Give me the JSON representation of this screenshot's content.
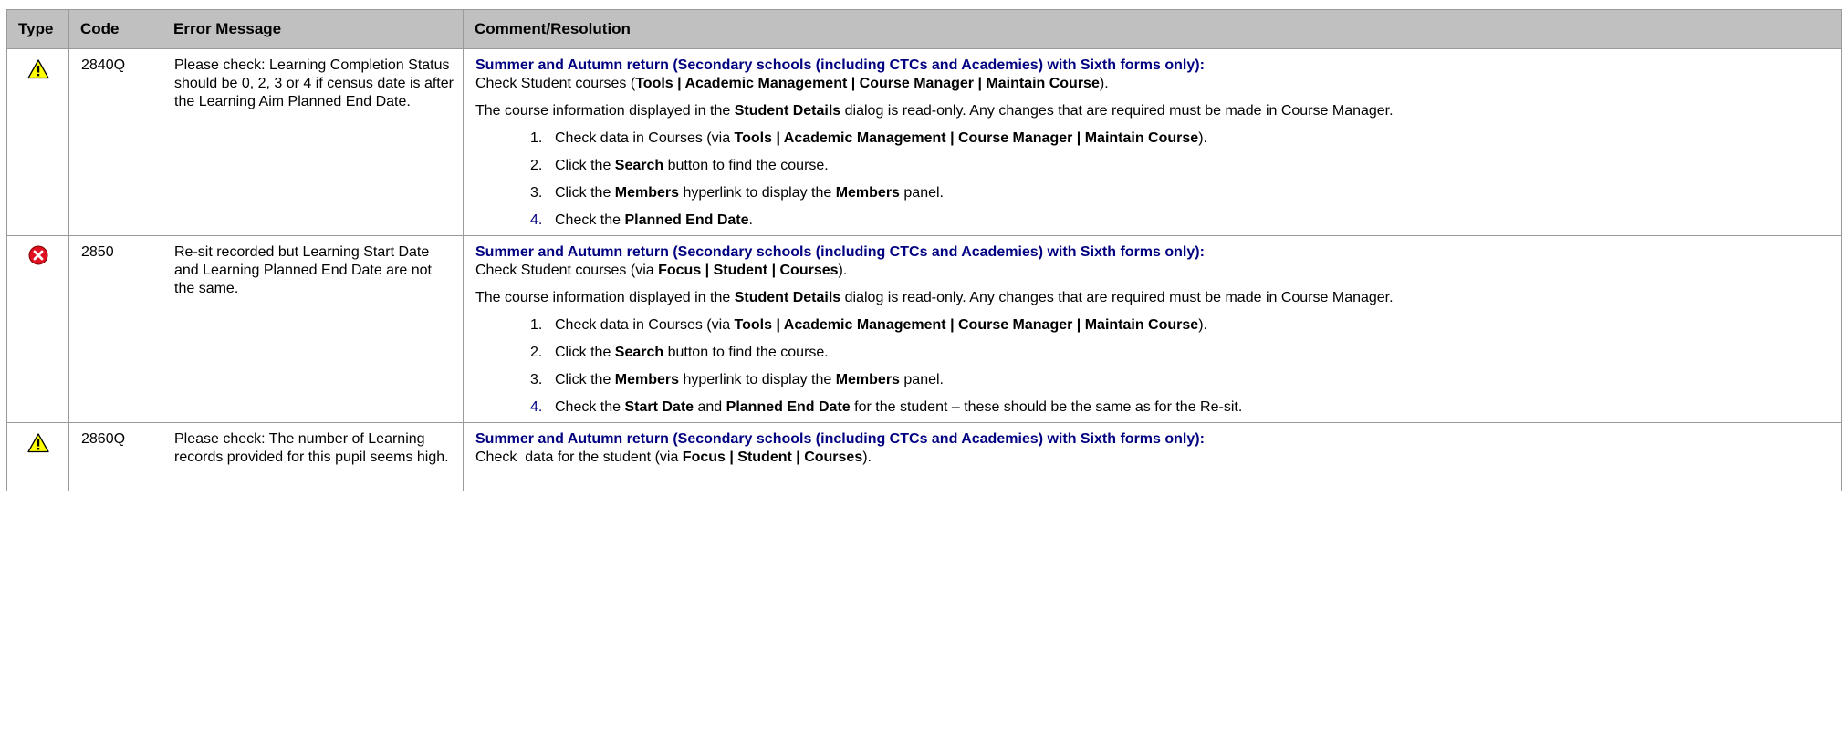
{
  "headers": {
    "type": "Type",
    "code": "Code",
    "message": "Error Message",
    "comment": "Comment/Resolution"
  },
  "colors": {
    "header_bg": "#c0c0c0",
    "heading_color": "#000080",
    "border": "#9a9a9a",
    "warning_fill": "#ffff00",
    "error_fill": "#e01020"
  },
  "rows": [
    {
      "icon": "warning-icon",
      "code": "2840Q",
      "message": "Please check: Learning Completion Status should be 0, 2, 3 or 4 if census date is after the Learning Aim Planned End Date.",
      "heading": "Summer and Autumn return (Secondary schools (including CTCs and Academies) with Sixth forms only):",
      "check_prefix": "Check Student courses (",
      "check_bold": "Tools | Academic Management | Course Manager | Maintain Course",
      "check_suffix": ").",
      "para2_a": "The course information displayed in the ",
      "para2_b": "Student Details",
      "para2_c": " dialog is read-only. Any changes that are required must be made in Course Manager.",
      "steps": [
        {
          "num": "1.",
          "a": "Check data in Courses (via ",
          "b": "Tools | Academic Management | Course Manager | Maintain Course",
          "c": ")."
        },
        {
          "num": "2.",
          "a": "Click the ",
          "b": "Search",
          "c": " button to find the course."
        },
        {
          "num": "3.",
          "a": "Click the ",
          "b": "Members",
          "c": " hyperlink to display the ",
          "d": "Members",
          "e": " panel."
        },
        {
          "num": "4.",
          "a": "Check the ",
          "b": "Planned End Date",
          "c": "."
        }
      ]
    },
    {
      "icon": "error-icon",
      "code": "2850",
      "message": "Re-sit recorded but Learning Start Date and Learning Planned End Date are not the same.",
      "heading": "Summer and Autumn return (Secondary schools (including CTCs and Academies) with Sixth forms only):",
      "check_prefix": "Check Student courses (via ",
      "check_bold": "Focus | Student | Courses",
      "check_suffix": ").",
      "para2_a": "The course information displayed in the ",
      "para2_b": "Student Details",
      "para2_c": " dialog is read-only. Any changes that are required must be made in Course Manager.",
      "steps": [
        {
          "num": "1.",
          "a": "Check data in Courses (via ",
          "b": "Tools | Academic Management | Course Manager | Maintain Course",
          "c": ")."
        },
        {
          "num": "2.",
          "a": "Click the ",
          "b": "Search",
          "c": " button to find the course."
        },
        {
          "num": "3.",
          "a": "Click the ",
          "b": "Members",
          "c": " hyperlink to display the ",
          "d": "Members",
          "e": " panel."
        },
        {
          "num": "4.",
          "a": "Check the ",
          "b": "Start Date",
          "c": " and ",
          "d": "Planned End Date",
          "e": " for the student – these should be the same as for the Re-sit."
        }
      ]
    },
    {
      "icon": "warning-icon",
      "code": "2860Q",
      "message": "Please check: The number of Learning records provided for this pupil seems high.",
      "heading": "Summer and Autumn return (Secondary schools (including CTCs and Academies) with Sixth forms only):",
      "check_prefix": "Check  data for the student (via ",
      "check_bold": "Focus | Student | Courses",
      "check_suffix": ")."
    }
  ]
}
